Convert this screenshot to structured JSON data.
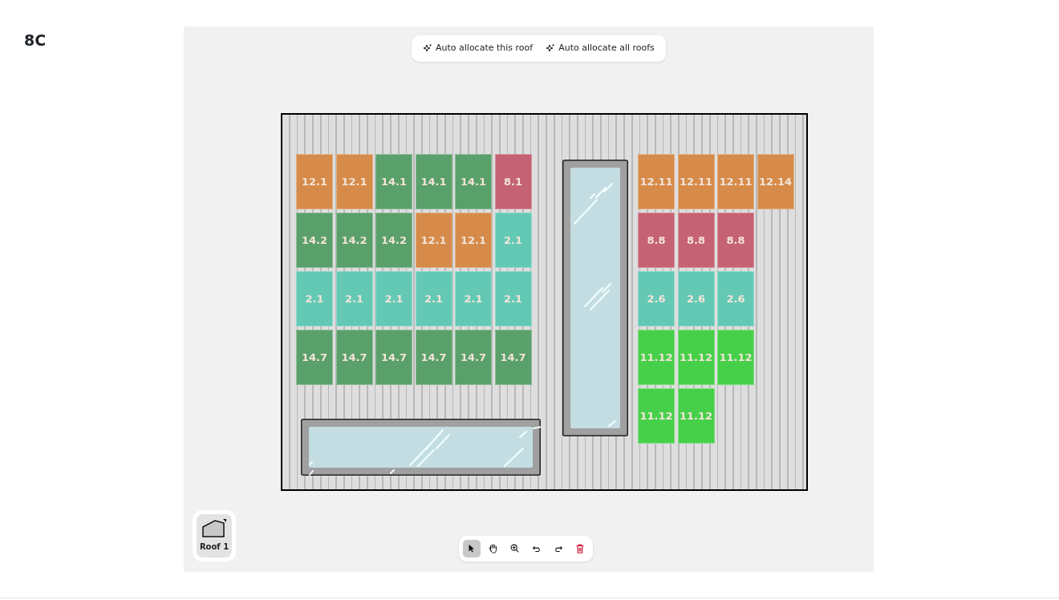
{
  "page_title": "8C",
  "top_actions": [
    {
      "label": "Auto allocate this roof"
    },
    {
      "label": "Auto allocate all roofs"
    }
  ],
  "left_array": {
    "rows": [
      [
        {
          "label": "12.1",
          "color": "#d68b4a"
        },
        {
          "label": "12.1",
          "color": "#d68b4a"
        },
        {
          "label": "14.1",
          "color": "#5aa06a"
        },
        {
          "label": "14.1",
          "color": "#5aa06a"
        },
        {
          "label": "14.1",
          "color": "#5aa06a"
        },
        {
          "label": "8.1",
          "color": "#c56273"
        }
      ],
      [
        {
          "label": "14.2",
          "color": "#5aa06a"
        },
        {
          "label": "14.2",
          "color": "#5aa06a"
        },
        {
          "label": "14.2",
          "color": "#5aa06a"
        },
        {
          "label": "12.1",
          "color": "#d68b4a"
        },
        {
          "label": "12.1",
          "color": "#d68b4a"
        },
        {
          "label": "2.1",
          "color": "#63c9b5"
        }
      ],
      [
        {
          "label": "2.1",
          "color": "#63c9b5"
        },
        {
          "label": "2.1",
          "color": "#63c9b5"
        },
        {
          "label": "2.1",
          "color": "#63c9b5"
        },
        {
          "label": "2.1",
          "color": "#63c9b5"
        },
        {
          "label": "2.1",
          "color": "#63c9b5"
        },
        {
          "label": "2.1",
          "color": "#63c9b5"
        }
      ],
      [
        {
          "label": "14.7",
          "color": "#5aa06a"
        },
        {
          "label": "14.7",
          "color": "#5aa06a"
        },
        {
          "label": "14.7",
          "color": "#5aa06a"
        },
        {
          "label": "14.7",
          "color": "#5aa06a"
        },
        {
          "label": "14.7",
          "color": "#5aa06a"
        },
        {
          "label": "14.7",
          "color": "#5aa06a"
        }
      ]
    ]
  },
  "right_array": {
    "rows": [
      [
        {
          "label": "12.11",
          "color": "#d68b4a"
        },
        {
          "label": "12.11",
          "color": "#d68b4a"
        },
        {
          "label": "12.11",
          "color": "#d68b4a"
        },
        {
          "label": "12.14",
          "color": "#d68b4a"
        }
      ],
      [
        {
          "label": "8.8",
          "color": "#c56273"
        },
        {
          "label": "8.8",
          "color": "#c56273"
        },
        {
          "label": "8.8",
          "color": "#c56273"
        }
      ],
      [
        {
          "label": "2.6",
          "color": "#63c9b5"
        },
        {
          "label": "2.6",
          "color": "#63c9b5"
        },
        {
          "label": "2.6",
          "color": "#63c9b5"
        }
      ],
      [
        {
          "label": "11.12",
          "color": "#46d04a"
        },
        {
          "label": "11.12",
          "color": "#46d04a"
        },
        {
          "label": "11.12",
          "color": "#46d04a"
        }
      ],
      [
        {
          "label": "11.12",
          "color": "#46d04a"
        },
        {
          "label": "11.12",
          "color": "#46d04a"
        }
      ]
    ]
  },
  "roof_tabs": [
    {
      "label": "Roof 1",
      "selected": true
    }
  ],
  "tools": [
    {
      "kind": "select",
      "selected": true
    },
    {
      "kind": "pan",
      "selected": false
    },
    {
      "kind": "zoom",
      "selected": false
    },
    {
      "kind": "undo",
      "selected": false
    },
    {
      "kind": "redo",
      "selected": false
    },
    {
      "kind": "delete",
      "selected": false
    }
  ]
}
